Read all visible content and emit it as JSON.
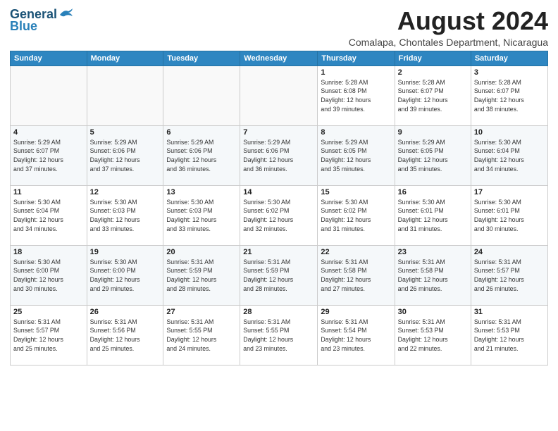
{
  "logo": {
    "line1": "General",
    "line2": "Blue"
  },
  "title": "August 2024",
  "location": "Comalapa, Chontales Department, Nicaragua",
  "weekdays": [
    "Sunday",
    "Monday",
    "Tuesday",
    "Wednesday",
    "Thursday",
    "Friday",
    "Saturday"
  ],
  "weeks": [
    [
      {
        "day": "",
        "info": ""
      },
      {
        "day": "",
        "info": ""
      },
      {
        "day": "",
        "info": ""
      },
      {
        "day": "",
        "info": ""
      },
      {
        "day": "1",
        "info": "Sunrise: 5:28 AM\nSunset: 6:08 PM\nDaylight: 12 hours\nand 39 minutes."
      },
      {
        "day": "2",
        "info": "Sunrise: 5:28 AM\nSunset: 6:07 PM\nDaylight: 12 hours\nand 39 minutes."
      },
      {
        "day": "3",
        "info": "Sunrise: 5:28 AM\nSunset: 6:07 PM\nDaylight: 12 hours\nand 38 minutes."
      }
    ],
    [
      {
        "day": "4",
        "info": "Sunrise: 5:29 AM\nSunset: 6:07 PM\nDaylight: 12 hours\nand 37 minutes."
      },
      {
        "day": "5",
        "info": "Sunrise: 5:29 AM\nSunset: 6:06 PM\nDaylight: 12 hours\nand 37 minutes."
      },
      {
        "day": "6",
        "info": "Sunrise: 5:29 AM\nSunset: 6:06 PM\nDaylight: 12 hours\nand 36 minutes."
      },
      {
        "day": "7",
        "info": "Sunrise: 5:29 AM\nSunset: 6:06 PM\nDaylight: 12 hours\nand 36 minutes."
      },
      {
        "day": "8",
        "info": "Sunrise: 5:29 AM\nSunset: 6:05 PM\nDaylight: 12 hours\nand 35 minutes."
      },
      {
        "day": "9",
        "info": "Sunrise: 5:29 AM\nSunset: 6:05 PM\nDaylight: 12 hours\nand 35 minutes."
      },
      {
        "day": "10",
        "info": "Sunrise: 5:30 AM\nSunset: 6:04 PM\nDaylight: 12 hours\nand 34 minutes."
      }
    ],
    [
      {
        "day": "11",
        "info": "Sunrise: 5:30 AM\nSunset: 6:04 PM\nDaylight: 12 hours\nand 34 minutes."
      },
      {
        "day": "12",
        "info": "Sunrise: 5:30 AM\nSunset: 6:03 PM\nDaylight: 12 hours\nand 33 minutes."
      },
      {
        "day": "13",
        "info": "Sunrise: 5:30 AM\nSunset: 6:03 PM\nDaylight: 12 hours\nand 33 minutes."
      },
      {
        "day": "14",
        "info": "Sunrise: 5:30 AM\nSunset: 6:02 PM\nDaylight: 12 hours\nand 32 minutes."
      },
      {
        "day": "15",
        "info": "Sunrise: 5:30 AM\nSunset: 6:02 PM\nDaylight: 12 hours\nand 31 minutes."
      },
      {
        "day": "16",
        "info": "Sunrise: 5:30 AM\nSunset: 6:01 PM\nDaylight: 12 hours\nand 31 minutes."
      },
      {
        "day": "17",
        "info": "Sunrise: 5:30 AM\nSunset: 6:01 PM\nDaylight: 12 hours\nand 30 minutes."
      }
    ],
    [
      {
        "day": "18",
        "info": "Sunrise: 5:30 AM\nSunset: 6:00 PM\nDaylight: 12 hours\nand 30 minutes."
      },
      {
        "day": "19",
        "info": "Sunrise: 5:30 AM\nSunset: 6:00 PM\nDaylight: 12 hours\nand 29 minutes."
      },
      {
        "day": "20",
        "info": "Sunrise: 5:31 AM\nSunset: 5:59 PM\nDaylight: 12 hours\nand 28 minutes."
      },
      {
        "day": "21",
        "info": "Sunrise: 5:31 AM\nSunset: 5:59 PM\nDaylight: 12 hours\nand 28 minutes."
      },
      {
        "day": "22",
        "info": "Sunrise: 5:31 AM\nSunset: 5:58 PM\nDaylight: 12 hours\nand 27 minutes."
      },
      {
        "day": "23",
        "info": "Sunrise: 5:31 AM\nSunset: 5:58 PM\nDaylight: 12 hours\nand 26 minutes."
      },
      {
        "day": "24",
        "info": "Sunrise: 5:31 AM\nSunset: 5:57 PM\nDaylight: 12 hours\nand 26 minutes."
      }
    ],
    [
      {
        "day": "25",
        "info": "Sunrise: 5:31 AM\nSunset: 5:57 PM\nDaylight: 12 hours\nand 25 minutes."
      },
      {
        "day": "26",
        "info": "Sunrise: 5:31 AM\nSunset: 5:56 PM\nDaylight: 12 hours\nand 25 minutes."
      },
      {
        "day": "27",
        "info": "Sunrise: 5:31 AM\nSunset: 5:55 PM\nDaylight: 12 hours\nand 24 minutes."
      },
      {
        "day": "28",
        "info": "Sunrise: 5:31 AM\nSunset: 5:55 PM\nDaylight: 12 hours\nand 23 minutes."
      },
      {
        "day": "29",
        "info": "Sunrise: 5:31 AM\nSunset: 5:54 PM\nDaylight: 12 hours\nand 23 minutes."
      },
      {
        "day": "30",
        "info": "Sunrise: 5:31 AM\nSunset: 5:53 PM\nDaylight: 12 hours\nand 22 minutes."
      },
      {
        "day": "31",
        "info": "Sunrise: 5:31 AM\nSunset: 5:53 PM\nDaylight: 12 hours\nand 21 minutes."
      }
    ]
  ]
}
